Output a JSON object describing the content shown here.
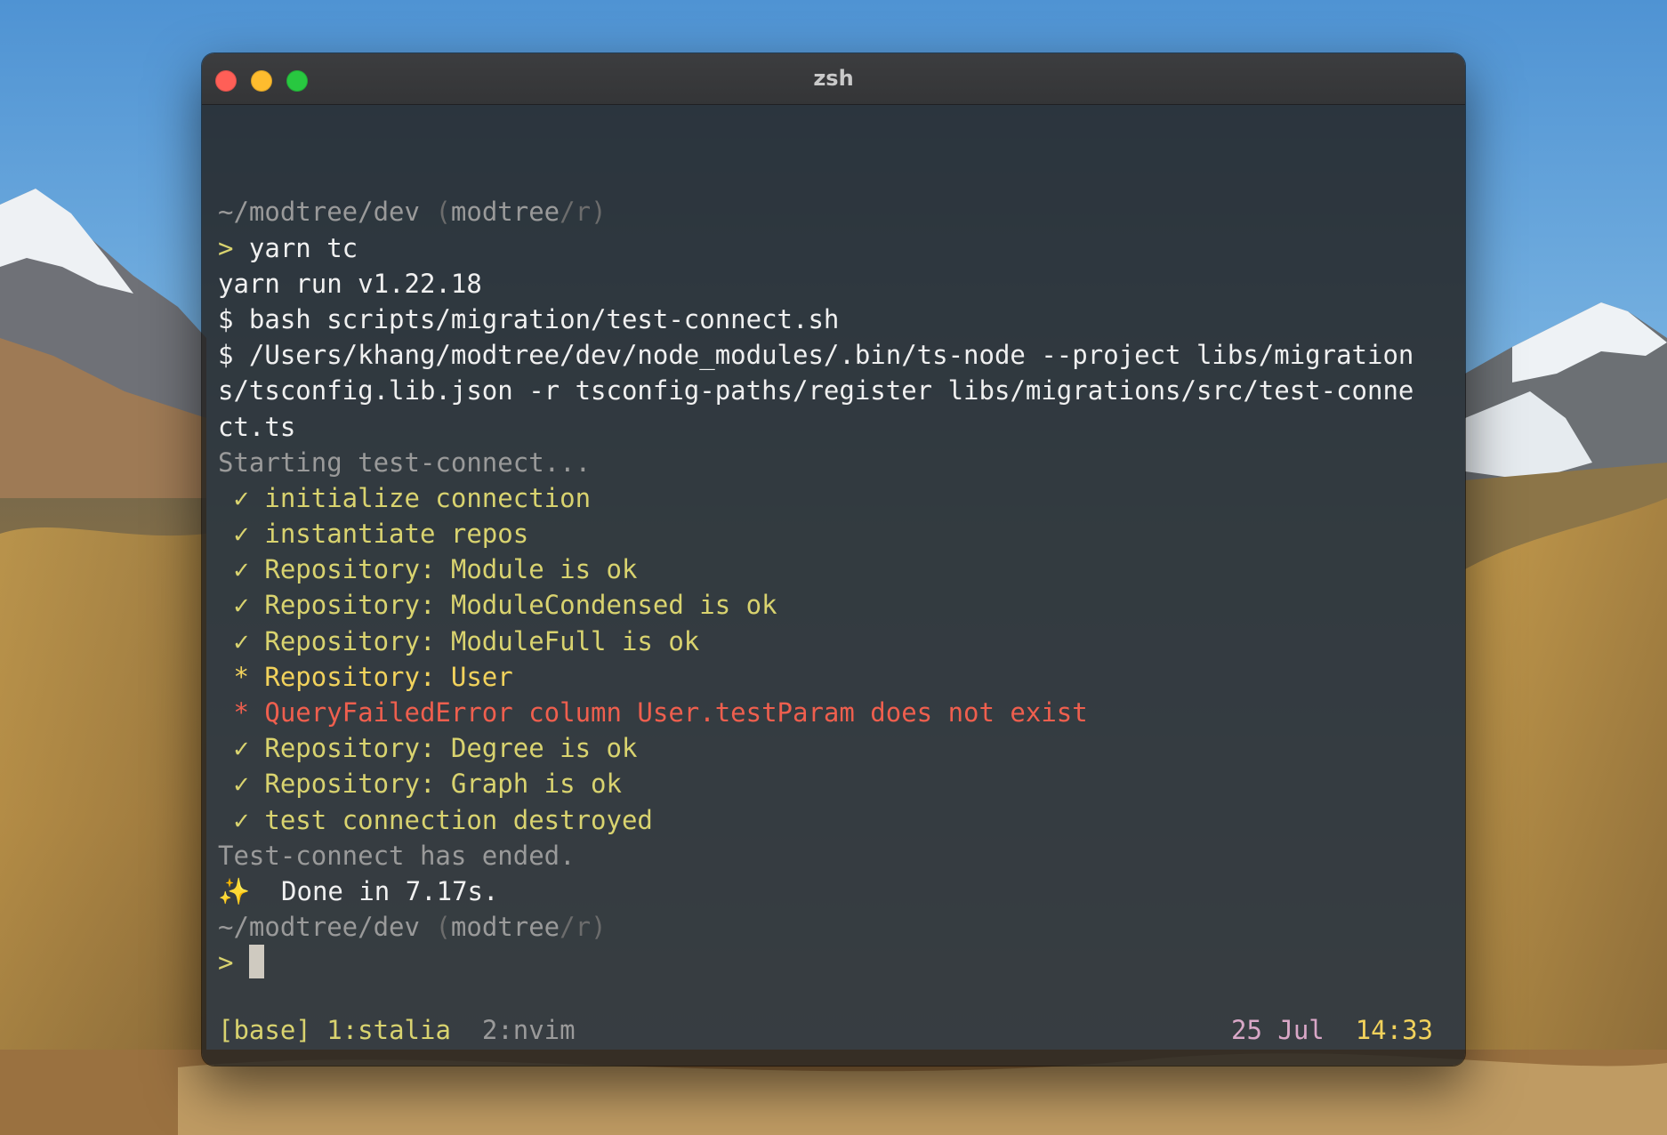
{
  "window": {
    "title": "zsh",
    "buttons": [
      "close",
      "minimize",
      "zoom"
    ]
  },
  "terminal": {
    "lines": [
      {
        "segments": [
          {
            "text": "~/modtree/dev",
            "style": "dim"
          },
          {
            "text": " (",
            "style": "dimmer"
          },
          {
            "text": "modtree",
            "style": "dim"
          },
          {
            "text": "/",
            "style": "dimmer"
          },
          {
            "text": "r",
            "style": "dimmer"
          },
          {
            "text": ")",
            "style": "dimmer"
          }
        ]
      },
      {
        "segments": [
          {
            "text": "> ",
            "style": "yellow"
          },
          {
            "text": "yarn tc",
            "style": "white"
          }
        ]
      },
      {
        "segments": [
          {
            "text": "yarn run v1.22.18",
            "style": "white"
          }
        ]
      },
      {
        "segments": [
          {
            "text": "$ bash scripts/migration/test-connect.sh",
            "style": "white"
          }
        ]
      },
      {
        "segments": [
          {
            "text": "$ /Users/khang/modtree/dev/node_modules/.bin/ts-node --project libs/migration",
            "style": "white"
          }
        ]
      },
      {
        "segments": [
          {
            "text": "s/tsconfig.lib.json -r tsconfig-paths/register libs/migrations/src/test-conne",
            "style": "white"
          }
        ]
      },
      {
        "segments": [
          {
            "text": "ct.ts",
            "style": "white"
          }
        ]
      },
      {
        "segments": [
          {
            "text": "Starting test-connect...",
            "style": "dim"
          }
        ]
      },
      {
        "segments": [
          {
            "text": " ✓ initialize connection",
            "style": "yellow"
          }
        ]
      },
      {
        "segments": [
          {
            "text": " ✓ instantiate repos",
            "style": "yellow"
          }
        ]
      },
      {
        "segments": [
          {
            "text": " ✓ Repository: Module is ok",
            "style": "yellow"
          }
        ]
      },
      {
        "segments": [
          {
            "text": " ✓ Repository: ModuleCondensed is ok",
            "style": "yellow"
          }
        ]
      },
      {
        "segments": [
          {
            "text": " ✓ Repository: ModuleFull is ok",
            "style": "yellow"
          }
        ]
      },
      {
        "segments": [
          {
            "text": " * Repository: User",
            "style": "amber"
          }
        ]
      },
      {
        "segments": [
          {
            "text": " * QueryFailedError column User.testParam does not exist",
            "style": "red"
          }
        ]
      },
      {
        "segments": [
          {
            "text": " ✓ Repository: Degree is ok",
            "style": "yellow"
          }
        ]
      },
      {
        "segments": [
          {
            "text": " ✓ Repository: Graph is ok",
            "style": "yellow"
          }
        ]
      },
      {
        "segments": [
          {
            "text": " ✓ test connection destroyed",
            "style": "yellow"
          }
        ]
      },
      {
        "segments": [
          {
            "text": "Test-connect has ended.",
            "style": "dim"
          }
        ]
      },
      {
        "segments": [
          {
            "text": "✨",
            "style": "sparkle"
          },
          {
            "text": "  Done in 7.17s.",
            "style": "white"
          }
        ]
      },
      {
        "segments": [
          {
            "text": "~/modtree/dev",
            "style": "dim"
          },
          {
            "text": " (",
            "style": "dimmer"
          },
          {
            "text": "modtree",
            "style": "dim"
          },
          {
            "text": "/",
            "style": "dimmer"
          },
          {
            "text": "r",
            "style": "dimmer"
          },
          {
            "text": ")",
            "style": "dimmer"
          }
        ]
      },
      {
        "segments": [
          {
            "text": "> ",
            "style": "yellow"
          }
        ],
        "cursor": true
      }
    ]
  },
  "statusbar": {
    "session": "[base]",
    "window_active": "1:stalia",
    "window_other": "2:nvim",
    "date": "25 Jul",
    "time": "14:33"
  },
  "colors": {
    "terminal_bg": "#222120",
    "text_white": "#f0f0f0",
    "text_dim": "#9a9a9a",
    "success_yellow": "#d9d36f",
    "error_red": "#ef5f4e",
    "date_pink": "#d9a7c7",
    "time_amber": "#f2d25c",
    "close_red": "#ff5f57",
    "minimize_yellow": "#febc2e",
    "zoom_green": "#28c840"
  }
}
